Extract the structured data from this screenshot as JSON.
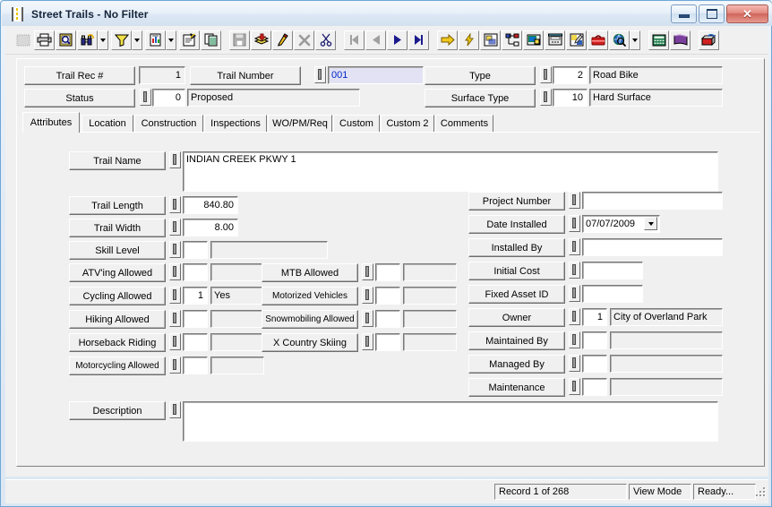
{
  "window": {
    "title": "Street Trails - No Filter",
    "app_icon": "road-trail-icon",
    "minimize_label": "Minimize",
    "maximize_label": "Maximize",
    "close_label": "Close"
  },
  "toolbar": {
    "groups": [
      {
        "buttons": [
          {
            "name": "select-tool",
            "icon": "dotted-rectangle-icon",
            "enabled": false
          },
          {
            "name": "print-button",
            "icon": "printer-icon",
            "enabled": true
          },
          {
            "name": "print-preview-button",
            "icon": "preview-magnifier-icon",
            "enabled": true
          },
          {
            "name": "find-button",
            "icon": "binoculars-icon",
            "enabled": true,
            "dropdown": true
          },
          {
            "name": "filter-button",
            "icon": "funnel-icon",
            "enabled": true,
            "dropdown": true
          },
          {
            "name": "report-button",
            "icon": "report-page-icon",
            "enabled": true,
            "dropdown": true
          },
          {
            "name": "properties-button",
            "icon": "properties-pin-icon",
            "enabled": true
          },
          {
            "name": "copy-record-button",
            "icon": "copy-pages-icon",
            "enabled": true
          }
        ]
      },
      {
        "buttons": [
          {
            "name": "save-button",
            "icon": "floppy-disk-icon",
            "enabled": false
          },
          {
            "name": "add-record-button",
            "icon": "add-stack-icon",
            "enabled": true
          },
          {
            "name": "edit-record-button",
            "icon": "pencil-icon",
            "enabled": true
          },
          {
            "name": "delete-record-button",
            "icon": "x-delete-icon",
            "enabled": false
          },
          {
            "name": "cut-button",
            "icon": "scissors-icon",
            "enabled": true
          }
        ]
      },
      {
        "buttons": [
          {
            "name": "first-record-button",
            "icon": "first-record-icon",
            "enabled": false
          },
          {
            "name": "previous-record-button",
            "icon": "previous-record-icon",
            "enabled": false
          },
          {
            "name": "next-record-button",
            "icon": "next-record-icon",
            "enabled": true
          },
          {
            "name": "last-record-button",
            "icon": "last-record-icon",
            "enabled": true
          }
        ]
      },
      {
        "buttons": [
          {
            "name": "goto-button",
            "icon": "yellow-arrow-icon",
            "enabled": true
          },
          {
            "name": "quick-action-button",
            "icon": "lightning-bolt-icon",
            "enabled": true
          },
          {
            "name": "map-link-button",
            "icon": "map-frame-icon",
            "enabled": true
          },
          {
            "name": "hierarchy-button",
            "icon": "tree-nodes-icon",
            "enabled": true
          },
          {
            "name": "screen-button",
            "icon": "monitor-icon",
            "enabled": true
          },
          {
            "name": "phone-button",
            "icon": "telephone-icon",
            "enabled": true
          },
          {
            "name": "image-button",
            "icon": "picture-pencil-icon",
            "enabled": true
          },
          {
            "name": "toolbox-button",
            "icon": "red-toolbox-icon",
            "enabled": true
          },
          {
            "name": "web-search-button",
            "icon": "globe-magnifier-icon",
            "enabled": true,
            "dropdown": true
          }
        ]
      },
      {
        "buttons": [
          {
            "name": "calculator-button",
            "icon": "calculator-icon",
            "enabled": true
          },
          {
            "name": "help-book-button",
            "icon": "purple-book-icon",
            "enabled": true
          }
        ]
      },
      {
        "buttons": [
          {
            "name": "exit-button",
            "icon": "exit-door-icon",
            "enabled": true
          }
        ]
      }
    ]
  },
  "header": {
    "trail_rec": {
      "label": "Trail Rec #",
      "value": "1"
    },
    "trail_number": {
      "label": "Trail Number",
      "value": "001"
    },
    "type": {
      "label": "Type",
      "code": "2",
      "description": "Road Bike"
    },
    "status": {
      "label": "Status",
      "code": "0",
      "description": "Proposed"
    },
    "surface_type": {
      "label": "Surface Type",
      "code": "10",
      "description": "Hard Surface"
    }
  },
  "tabs": [
    {
      "label": "Attributes",
      "active": true
    },
    {
      "label": "Location",
      "active": false
    },
    {
      "label": "Construction",
      "active": false
    },
    {
      "label": "Inspections",
      "active": false
    },
    {
      "label": "WO/PM/Req",
      "active": false
    },
    {
      "label": "Custom",
      "active": false
    },
    {
      "label": "Custom 2",
      "active": false
    },
    {
      "label": "Comments",
      "active": false
    }
  ],
  "attributes": {
    "trail_name": {
      "label": "Trail Name",
      "value": "INDIAN CREEK PKWY 1"
    },
    "trail_length": {
      "label": "Trail Length",
      "value": "840.80"
    },
    "trail_width": {
      "label": "Trail Width",
      "value": "8.00"
    },
    "skill_level": {
      "label": "Skill Level",
      "code": "",
      "description": ""
    },
    "left_checks": [
      {
        "label": "ATV'ing Allowed",
        "code": "",
        "description": ""
      },
      {
        "label": "Cycling Allowed",
        "code": "1",
        "description": "Yes"
      },
      {
        "label": "Hiking Allowed",
        "code": "",
        "description": ""
      },
      {
        "label": "Horseback Riding",
        "code": "",
        "description": ""
      },
      {
        "label": "Motorcycling Allowed",
        "code": "",
        "description": ""
      }
    ],
    "mid_checks": [
      {
        "label": "MTB Allowed",
        "code": "",
        "description": ""
      },
      {
        "label": "Motorized Vehicles",
        "code": "",
        "description": ""
      },
      {
        "label": "Snowmobiling Allowed",
        "code": "",
        "description": ""
      },
      {
        "label": "X Country Skiing",
        "code": "",
        "description": ""
      }
    ],
    "right_fields": [
      {
        "label": "Project Number",
        "value": "",
        "kind": "text-wide"
      },
      {
        "label": "Date Installed",
        "value": "07/07/2009",
        "kind": "date"
      },
      {
        "label": "Installed By",
        "value": "",
        "kind": "text-wide"
      },
      {
        "label": "Initial Cost",
        "value": "",
        "kind": "text-short"
      },
      {
        "label": "Fixed Asset ID",
        "value": "",
        "kind": "text-short"
      },
      {
        "label": "Owner",
        "code": "1",
        "description": "City of Overland Park",
        "kind": "lookup"
      },
      {
        "label": "Maintained By",
        "code": "",
        "description": "",
        "kind": "lookup"
      },
      {
        "label": "Managed By",
        "code": "",
        "description": "",
        "kind": "lookup"
      },
      {
        "label": "Maintenance",
        "code": "",
        "description": "",
        "kind": "lookup"
      }
    ],
    "description": {
      "label": "Description",
      "value": ""
    }
  },
  "statusbar": {
    "record": "Record 1 of 268",
    "mode": "View Mode",
    "state": "Ready..."
  }
}
